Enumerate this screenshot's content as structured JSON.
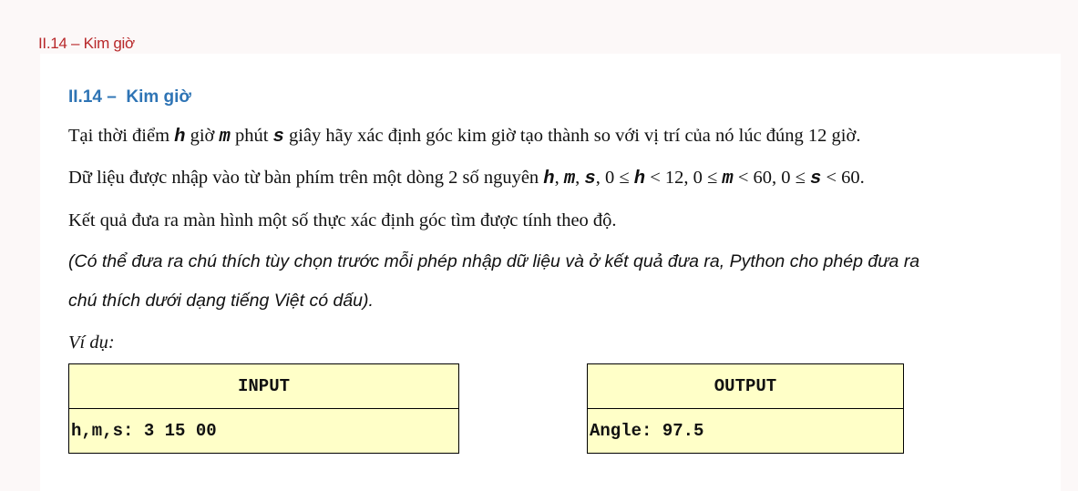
{
  "breadcrumb": "II.14 – Kim giờ",
  "heading": "II.14 –  Kim giờ",
  "para1": [
    "Tại thời điểm ",
    "h",
    " giờ ",
    "m",
    " phút ",
    "s",
    " giây hãy xác định góc kim giờ tạo thành so với vị trí của nó lúc đúng 12 giờ."
  ],
  "para2": [
    "Dữ liệu được nhập vào từ bàn phím trên một dòng 2 số nguyên ",
    "h",
    ", ",
    "m",
    ", ",
    "s",
    ", 0 ≤ ",
    "h",
    " < 12, 0 ≤ ",
    "m",
    " < 60, 0 ≤ ",
    "s",
    " < 60."
  ],
  "para3": "Kết quả đưa ra màn hình một số thực xác định góc tìm được tính theo độ.",
  "note_line1": "(Có thể đưa ra chú thích tùy chọn trước mỗi phép nhập dữ liệu và ở kết quả đưa ra, Python cho phép đưa ra",
  "note_line2": "chú thích dưới dạng tiếng Việt có dấu).",
  "example_label": "Ví dụ:",
  "input_table": {
    "header": "INPUT",
    "value": "h,m,s: 3 15 00"
  },
  "output_table": {
    "header": "OUTPUT",
    "value": "Angle: 97.5"
  }
}
